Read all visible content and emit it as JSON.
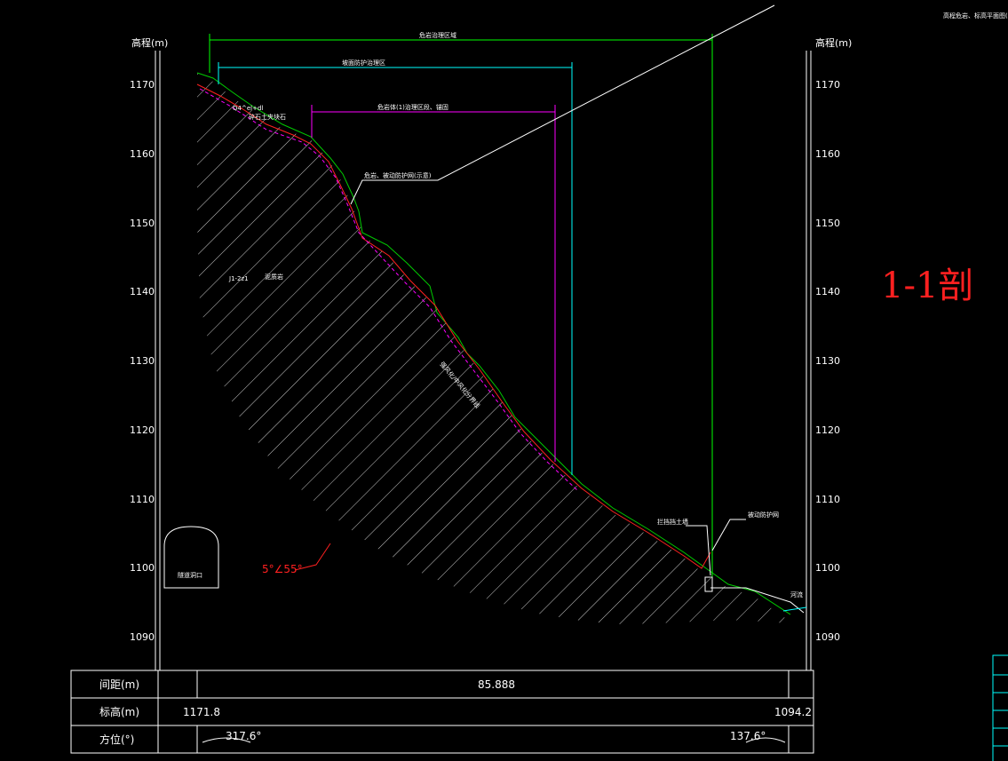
{
  "title_note": "高程危岩、标高平面图(示意)",
  "axis": {
    "left_label": "高程(m)",
    "right_label": "高程(m)",
    "ticks": [
      "1170",
      "1160",
      "1150",
      "1140",
      "1130",
      "1120",
      "1110",
      "1100",
      "1090"
    ]
  },
  "dims": {
    "top": "危岩治理区域",
    "middle": "坡面防护治理区",
    "inner": "危岩体(1)治理区段、锚固"
  },
  "labels": {
    "rock_ref": "Q4^el+dl",
    "rock_ref2": "碎石土夹块石",
    "unit_code": "J1-2z1",
    "unit_name": "泥质岩",
    "leader_top": "危岩、被动防护网(示意)",
    "slope_line": "强风化/中风化分界线",
    "wall_label": "拦挡挡土墙",
    "net_label": "被动防护网",
    "dip": "5°∠55°",
    "tunnel_label": "隧道洞口",
    "water_label": "河流",
    "handwritten": "1-1剖"
  },
  "table": {
    "rows": [
      {
        "label": "间距(m)",
        "left": "",
        "center": "85.888",
        "right": ""
      },
      {
        "label": "标高(m)",
        "left": "1171.8",
        "center": "",
        "right": "1094.2"
      },
      {
        "label": "方位(°)",
        "left": "317.6°",
        "center": "",
        "right": "137.6°"
      }
    ]
  },
  "colors": {
    "background": "#000000",
    "line": "#ffffff",
    "ground": "#00cc00",
    "surface_red": "#ff2020",
    "magenta": "#ff00ff",
    "cyan": "#00ffff",
    "green_dim": "#00ff00"
  }
}
